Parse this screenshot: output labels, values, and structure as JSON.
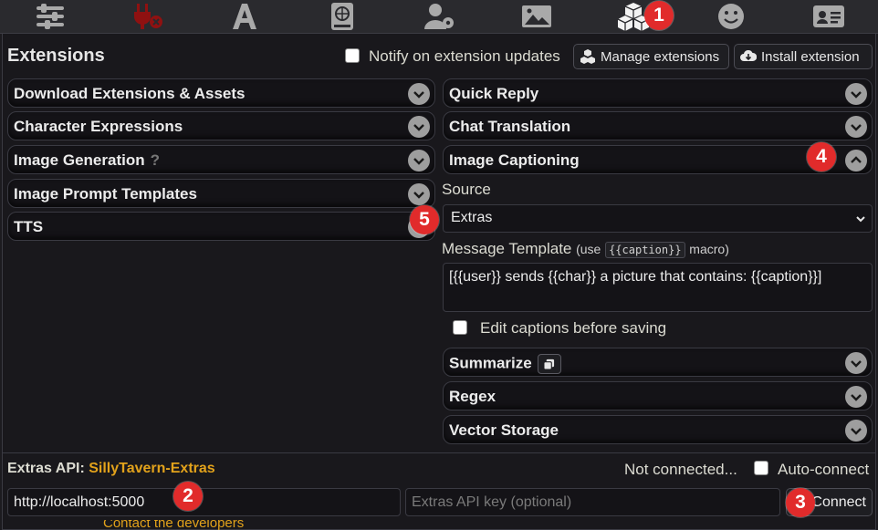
{
  "topbar": {
    "icons": [
      {
        "name": "sliders-icon"
      },
      {
        "name": "plug-icon"
      },
      {
        "name": "font-icon"
      },
      {
        "name": "globe-book-icon"
      },
      {
        "name": "user-gear-icon"
      },
      {
        "name": "image-icon"
      },
      {
        "name": "cubes-icon"
      },
      {
        "name": "smile-icon"
      },
      {
        "name": "id-card-icon"
      }
    ]
  },
  "badges": [
    "1",
    "2",
    "3",
    "4",
    "5"
  ],
  "extensions": {
    "title": "Extensions",
    "notify_label": "Notify on extension updates",
    "manage_label": "Manage extensions",
    "install_label": "Install extension"
  },
  "left_drawers": [
    {
      "title": "Download Extensions & Assets"
    },
    {
      "title": "Character Expressions"
    },
    {
      "title": "Image Generation",
      "help": "?"
    },
    {
      "title": "Image Prompt Templates"
    },
    {
      "title": "TTS"
    }
  ],
  "right_drawers": [
    {
      "title": "Quick Reply"
    },
    {
      "title": "Chat Translation"
    },
    {
      "title": "Image Captioning"
    },
    {
      "title": "Summarize"
    },
    {
      "title": "Regex"
    },
    {
      "title": "Vector Storage"
    }
  ],
  "captioning": {
    "source_label": "Source",
    "source_value": "Extras",
    "template_label": "Message Template",
    "template_hint_prefix": "(use",
    "template_hint_code": "{{caption}}",
    "template_hint_suffix": "macro)",
    "template_value": "[{{user}} sends {{char}} a picture that contains: {{caption}}]",
    "edit_before_saving": "Edit captions before saving"
  },
  "extras_api": {
    "label": "Extras API:",
    "link": "SillyTavern-Extras",
    "status": "Not connected...",
    "auto_connect": "Auto-connect",
    "url_value": "http://localhost:5000",
    "key_placeholder": "Extras API key (optional)",
    "connect_label": "Connect"
  },
  "footer": {
    "cut_text": "Contact the developers"
  },
  "colors": {
    "accent_orange": "#e2a21b",
    "badge_red": "#e12b2b",
    "plug_red": "#8f1111"
  }
}
